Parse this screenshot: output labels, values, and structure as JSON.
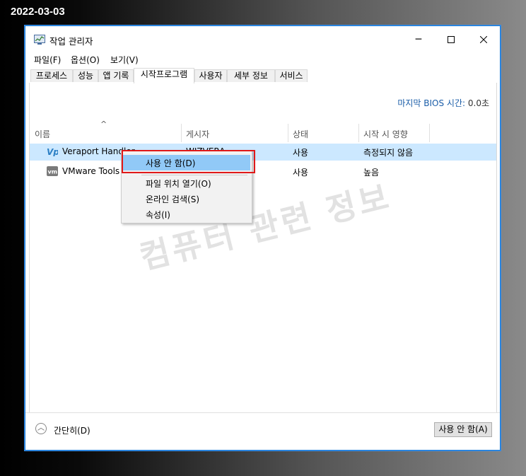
{
  "date_stamp": "2022-03-03",
  "window": {
    "title": "작업 관리자",
    "icons": {
      "app": "task-manager-icon",
      "minimize": "minimize-icon",
      "maximize": "maximize-icon",
      "close": "close-icon"
    }
  },
  "menubar": {
    "items": [
      "파일(F)",
      "옵션(O)",
      "보기(V)"
    ]
  },
  "tabs": [
    {
      "label": "프로세스",
      "active": false
    },
    {
      "label": "성능",
      "active": false
    },
    {
      "label": "앱 기록",
      "active": false
    },
    {
      "label": "시작프로그램",
      "active": true
    },
    {
      "label": "사용자",
      "active": false
    },
    {
      "label": "세부 정보",
      "active": false
    },
    {
      "label": "서비스",
      "active": false
    }
  ],
  "bios": {
    "label": "마지막 BIOS 시간:",
    "value": "0.0초"
  },
  "table": {
    "sort_indicator": "^",
    "columns": [
      "이름",
      "게시자",
      "상태",
      "시작 시 영향"
    ],
    "rows": [
      {
        "name": "Veraport Handler",
        "publisher": "WIZVERA",
        "status": "사용",
        "impact": "측정되지 않음",
        "icon": "veraport-icon",
        "selected": true
      },
      {
        "name": "VMware Tools",
        "publisher": "",
        "status": "사용",
        "impact": "높음",
        "icon": "vmware-icon",
        "selected": false
      }
    ]
  },
  "context_menu": {
    "items": [
      "사용 안 함(D)",
      "파일 위치 열기(O)",
      "온라인 검색(S)",
      "속성(I)"
    ]
  },
  "footer": {
    "fewer_details": "간단히(D)",
    "disable_button": "사용 안 함(A)"
  },
  "watermark": "컴퓨터 관련 정보",
  "colors": {
    "accent": "#1a7bd8",
    "selection": "#cce8ff",
    "menu_highlight": "#91c9f7",
    "red_box": "#e01919"
  }
}
